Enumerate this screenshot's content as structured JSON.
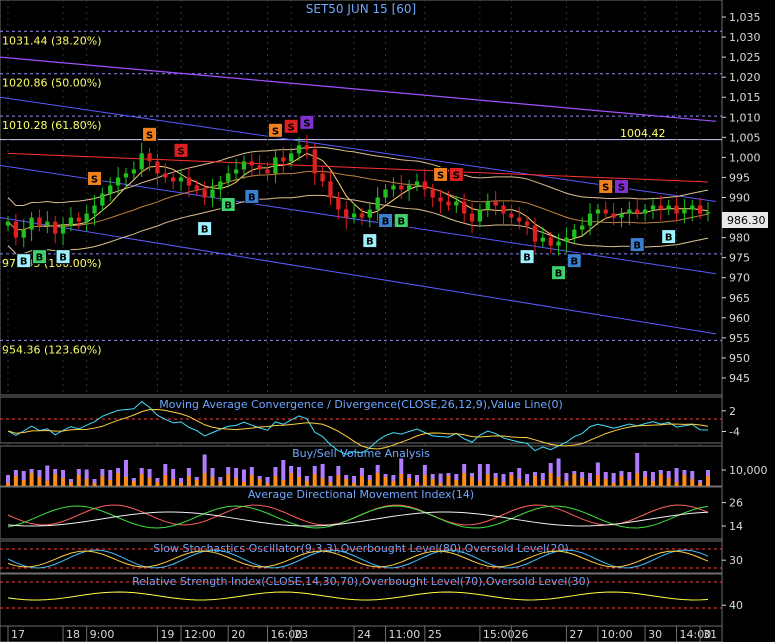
{
  "chart_data": {
    "type": "candlestick",
    "title": "SET50 JUN 15   [60]",
    "y_ticks": [
      "1,035",
      "1,030",
      "1,025",
      "1,020",
      "1,015",
      "1,010",
      "1,005",
      "1,000",
      "995",
      "990",
      "985",
      "980",
      "975",
      "970",
      "965",
      "960",
      "955",
      "950",
      "945"
    ],
    "ylim": [
      942,
      1038
    ],
    "fib_levels": [
      {
        "label": "1031.44 (38.20%)",
        "value": 1031.44
      },
      {
        "label": "1020.86 (50.00%)",
        "value": 1020.86
      },
      {
        "label": "1010.28 (61.80%)",
        "value": 1010.28
      },
      {
        "label": "975.95 (100.00%)",
        "value": 975.95
      },
      {
        "label": "954.36 (123.60%)",
        "value": 954.36
      }
    ],
    "price_label": "986.30",
    "marker_label": "1004.42",
    "x_labels": [
      {
        "i": 0,
        "text": "17"
      },
      {
        "i": 7,
        "text": "18"
      },
      {
        "i": 10,
        "text": "9:00"
      },
      {
        "i": 19,
        "text": "19"
      },
      {
        "i": 22,
        "text": "12:00"
      },
      {
        "i": 28,
        "text": "20"
      },
      {
        "i": 33,
        "text": "16:00"
      },
      {
        "i": 36,
        "text": "23"
      },
      {
        "i": 44,
        "text": "24"
      },
      {
        "i": 48,
        "text": "11:00"
      },
      {
        "i": 53,
        "text": "25"
      },
      {
        "i": 60,
        "text": "15:00"
      },
      {
        "i": 64,
        "text": "26"
      },
      {
        "i": 71,
        "text": "27"
      },
      {
        "i": 75,
        "text": "10:00"
      },
      {
        "i": 81,
        "text": "30"
      },
      {
        "i": 85,
        "text": "14:00"
      },
      {
        "i": 88,
        "text": "31"
      }
    ],
    "close": [
      984,
      980,
      982,
      985,
      983,
      984,
      981,
      983,
      985,
      984,
      986,
      988,
      991,
      993,
      995,
      996,
      997,
      1001,
      999,
      996,
      995,
      994,
      995,
      993,
      992,
      990,
      992,
      994,
      996,
      997,
      999,
      998,
      997,
      996,
      1000,
      999,
      1001,
      1003,
      1002,
      996,
      994,
      990,
      987,
      985,
      986,
      985,
      987,
      990,
      992,
      993,
      992,
      993,
      994,
      992,
      990,
      989,
      988,
      989,
      986,
      984,
      987,
      989,
      988,
      986,
      985,
      984,
      983,
      979,
      980,
      978,
      979,
      980,
      982,
      983,
      986,
      987,
      986,
      985,
      986,
      987,
      986,
      987,
      988,
      987,
      988,
      986,
      987,
      988,
      986,
      986.3
    ],
    "candle_range": [
      0,
      95
    ],
    "signals": [
      {
        "i": 2,
        "type": "B",
        "color": "#9ef0ff",
        "at": "low"
      },
      {
        "i": 4,
        "type": "B",
        "color": "#3fd070",
        "at": "low"
      },
      {
        "i": 7,
        "type": "B",
        "color": "#9ef0ff",
        "at": "low"
      },
      {
        "i": 11,
        "type": "S",
        "color": "#f08020",
        "at": "high"
      },
      {
        "i": 18,
        "type": "S",
        "color": "#f08020",
        "at": "high"
      },
      {
        "i": 22,
        "type": "S",
        "color": "#e02020",
        "at": "high"
      },
      {
        "i": 25,
        "type": "B",
        "color": "#9ef0ff",
        "at": "low"
      },
      {
        "i": 28,
        "type": "B",
        "color": "#3fd070",
        "at": "low"
      },
      {
        "i": 31,
        "type": "B",
        "color": "#3a7fd0",
        "at": "low"
      },
      {
        "i": 34,
        "type": "S",
        "color": "#f08020",
        "at": "high"
      },
      {
        "i": 36,
        "type": "S",
        "color": "#e02020",
        "at": "high"
      },
      {
        "i": 38,
        "type": "S",
        "color": "#8030d0",
        "at": "high"
      },
      {
        "i": 46,
        "type": "B",
        "color": "#9ef0ff",
        "at": "low"
      },
      {
        "i": 48,
        "type": "B",
        "color": "#3a7fd0",
        "at": "low"
      },
      {
        "i": 50,
        "type": "B",
        "color": "#3fd070",
        "at": "low"
      },
      {
        "i": 55,
        "type": "S",
        "color": "#f08020",
        "at": "high"
      },
      {
        "i": 57,
        "type": "S",
        "color": "#e02020",
        "at": "high"
      },
      {
        "i": 66,
        "type": "B",
        "color": "#9ef0ff",
        "at": "low"
      },
      {
        "i": 70,
        "type": "B",
        "color": "#3fd070",
        "at": "low"
      },
      {
        "i": 72,
        "type": "B",
        "color": "#3a7fd0",
        "at": "low"
      },
      {
        "i": 76,
        "type": "S",
        "color": "#f08020",
        "at": "high"
      },
      {
        "i": 78,
        "type": "S",
        "color": "#8030d0",
        "at": "high"
      },
      {
        "i": 80,
        "type": "B",
        "color": "#3a7fd0",
        "at": "low"
      },
      {
        "i": 84,
        "type": "B",
        "color": "#9ef0ff",
        "at": "low"
      }
    ],
    "indicators": [
      {
        "title": "Moving Average Convergence / Divergence(CLOSE,26,12,9),Value Line(0)",
        "ticks": [
          "2",
          "-4"
        ]
      },
      {
        "title": "Buy/Sell Volume Analysis",
        "ticks": [
          "10,000"
        ]
      },
      {
        "title": "Average Directional Movement Index(14)",
        "ticks": [
          "26",
          "14"
        ]
      },
      {
        "title": "Slow Stochastics Oscillator(9,3,3),Overbought Level(80),Oversold Level(20)",
        "ticks": [
          "30"
        ]
      },
      {
        "title": "Relative Strength Index(CLOSE,14,30,70),Overbought Level(70),Oversold Level(30)",
        "ticks": [
          "40"
        ]
      }
    ],
    "colors": {
      "up": "#20c020",
      "down": "#e02020",
      "axis": "#d8d8d8",
      "title": "#6fa8ff",
      "fib": "#ffff66",
      "channel": "#5a5aff",
      "resist": "#a050ff",
      "ma_fast": "#ffd070",
      "ma_mid": "#ff3030",
      "bb": "#e0c090",
      "vol_buy": "#ff8c1a",
      "vol_sell": "#b07cff"
    }
  }
}
